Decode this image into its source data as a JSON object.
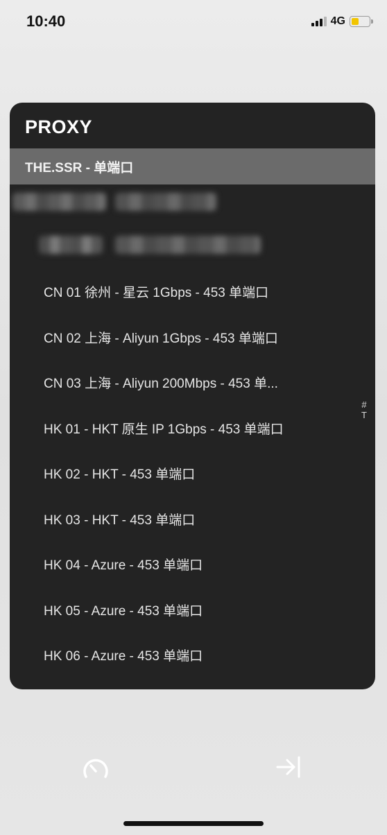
{
  "status_bar": {
    "time": "10:40",
    "network": "4G"
  },
  "panel": {
    "title": "PROXY",
    "selected_group": "THE.SSR - 单端口",
    "servers": [
      "CN 01 徐州 - 星云 1Gbps - 453 单端口",
      "CN 02 上海 - Aliyun 1Gbps - 453 单端口",
      "CN 03 上海 - Aliyun 200Mbps - 453 单...",
      "HK 01 - HKT 原生 IP 1Gbps - 453 单端口",
      "HK 02 - HKT - 453 单端口",
      "HK 03 - HKT - 453 单端口",
      "HK 04 - Azure - 453 单端口",
      "HK 05 - Azure - 453 单端口",
      "HK 06 - Azure - 453 单端口"
    ],
    "index": [
      "#",
      "T"
    ]
  },
  "bottom_bar": {
    "left_icon": "speedometer-icon",
    "right_icon": "exit-arrow-icon"
  },
  "colors": {
    "panel_bg": "#232323",
    "selected_row": "#6b6b6b",
    "battery": "#f2c500"
  }
}
